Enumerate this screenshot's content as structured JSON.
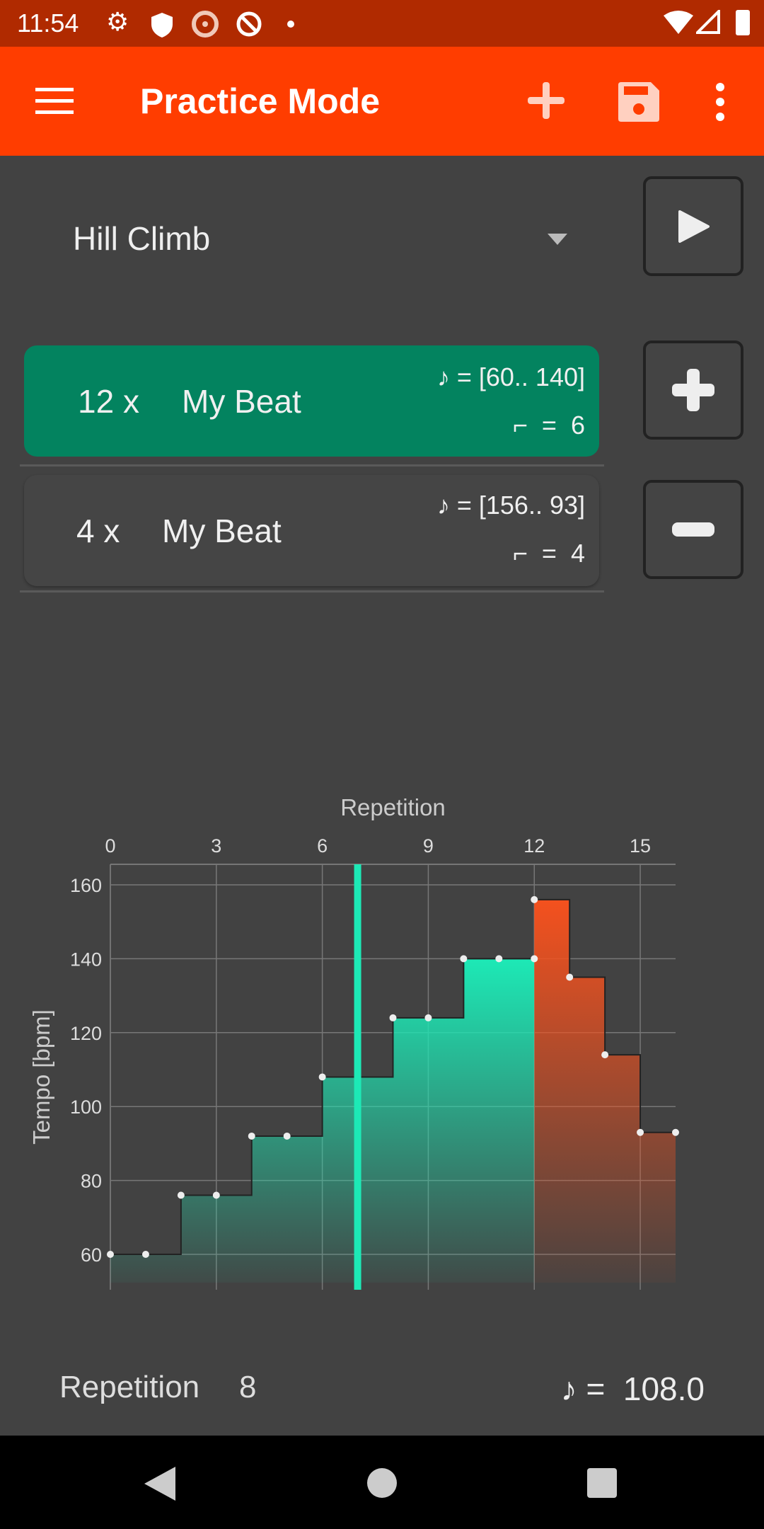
{
  "status_bar": {
    "time": "11:54",
    "icons": [
      "settings-icon",
      "shield-icon",
      "speed-icon",
      "no-location-icon",
      "dot-icon",
      "wifi-icon",
      "signal-icon",
      "battery-icon"
    ]
  },
  "toolbar": {
    "title": "Practice Mode",
    "icons": [
      "menu-icon",
      "add-icon",
      "save-icon",
      "more-vert-icon"
    ]
  },
  "program": {
    "selected": "Hill Climb"
  },
  "sections": [
    {
      "reps": "12 x",
      "name": "My Beat",
      "tempo_range": "[60.. 140]",
      "steps": "6",
      "selected": true,
      "color": "#03835f"
    },
    {
      "reps": "4 x",
      "name": "My Beat",
      "tempo_range": "[156.. 93]",
      "steps": "4",
      "selected": false,
      "color": "#454545"
    }
  ],
  "eq": "=",
  "chart_data": {
    "type": "area",
    "step": true,
    "xlabel": "Repetition",
    "ylabel": "Tempo [bpm]",
    "xlim": [
      0,
      16
    ],
    "ylim": [
      50,
      165
    ],
    "xticks": [
      0,
      3,
      6,
      9,
      12,
      15
    ],
    "yticks": [
      60,
      80,
      100,
      120,
      140,
      160
    ],
    "grid": true,
    "series": [
      {
        "x": [
          0,
          1,
          2,
          3,
          4,
          5,
          6,
          7,
          8,
          9,
          10,
          11,
          12
        ],
        "values": [
          60,
          60,
          76,
          76,
          92,
          92,
          108,
          108,
          124,
          124,
          140,
          140,
          140
        ],
        "color": "#1de9b6"
      },
      {
        "x": [
          12,
          13,
          14,
          15,
          16
        ],
        "values": [
          156,
          135,
          114,
          93,
          93
        ],
        "color": "#f4511e"
      }
    ],
    "cursor_x": 7,
    "cursor_color": "#1de9b6"
  },
  "footer": {
    "label": "Repetition",
    "value": "8",
    "tempo_eq": "=",
    "tempo": "108.0"
  }
}
